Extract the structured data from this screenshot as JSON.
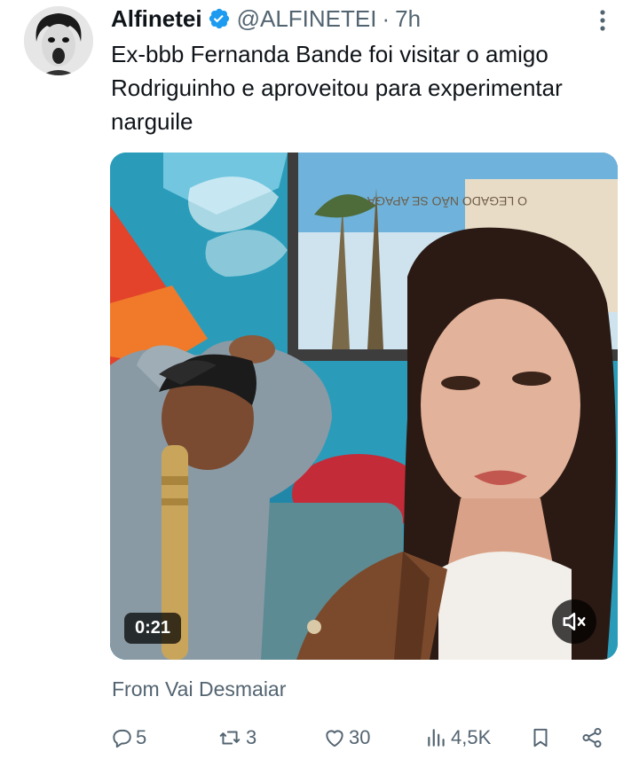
{
  "tweet": {
    "display_name": "Alfinetei",
    "handle": "@ALFINETEI",
    "separator": "·",
    "time": "7h",
    "text": "Ex-bbb Fernanda Bande foi visitar o amigo Rodriguinho e aproveitou para experimentar narguile",
    "verified": true
  },
  "media": {
    "type": "video",
    "duration": "0:21",
    "muted": true,
    "background_sign_text": "O LEGADO NÃO SE APAGA"
  },
  "source": "From Vai Desmaiar",
  "actions": {
    "reply_count": "5",
    "retweet_count": "3",
    "like_count": "30",
    "views_count": "4,5K"
  },
  "icons": {
    "verified": "verified-badge-icon",
    "more": "more-dots-icon",
    "reply": "reply-icon",
    "retweet": "retweet-icon",
    "like": "heart-icon",
    "views": "views-icon",
    "bookmark": "bookmark-icon",
    "share": "share-icon",
    "mute": "volume-muted-icon"
  },
  "colors": {
    "verified_blue": "#1d9bf0",
    "secondary_text": "#536471",
    "primary_text": "#0f1419"
  }
}
